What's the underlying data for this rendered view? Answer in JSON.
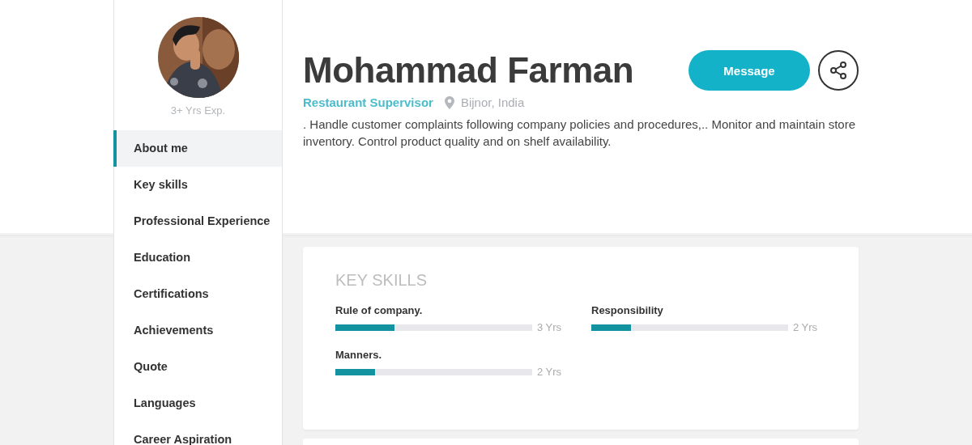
{
  "profile": {
    "experience": "3+ Yrs Exp.",
    "name": "Mohammad Farman",
    "role": "Restaurant Supervisor",
    "location": "Bijnor, India",
    "summary": ". Handle customer complaints following company policies and procedures,.. Monitor and maintain store inventory. Control product quality and on shelf availability.",
    "message_button": "Message"
  },
  "sidebar": {
    "items": [
      {
        "label": "About me",
        "selected": true
      },
      {
        "label": "Key skills",
        "selected": false
      },
      {
        "label": "Professional Experience",
        "selected": false
      },
      {
        "label": "Education",
        "selected": false
      },
      {
        "label": "Certifications",
        "selected": false
      },
      {
        "label": "Achievements",
        "selected": false
      },
      {
        "label": "Quote",
        "selected": false
      },
      {
        "label": "Languages",
        "selected": false
      },
      {
        "label": "Career Aspiration",
        "selected": false
      }
    ]
  },
  "key_skills": {
    "title": "KEY SKILLS",
    "skills": [
      {
        "name": "Rule of company.",
        "level": 0.3,
        "reading": "3 Yrs"
      },
      {
        "name": "Responsibility",
        "level": 0.2,
        "reading": "2 Yrs"
      },
      {
        "name": "Manners.",
        "level": 0.2,
        "reading": "2 Yrs"
      }
    ]
  }
}
